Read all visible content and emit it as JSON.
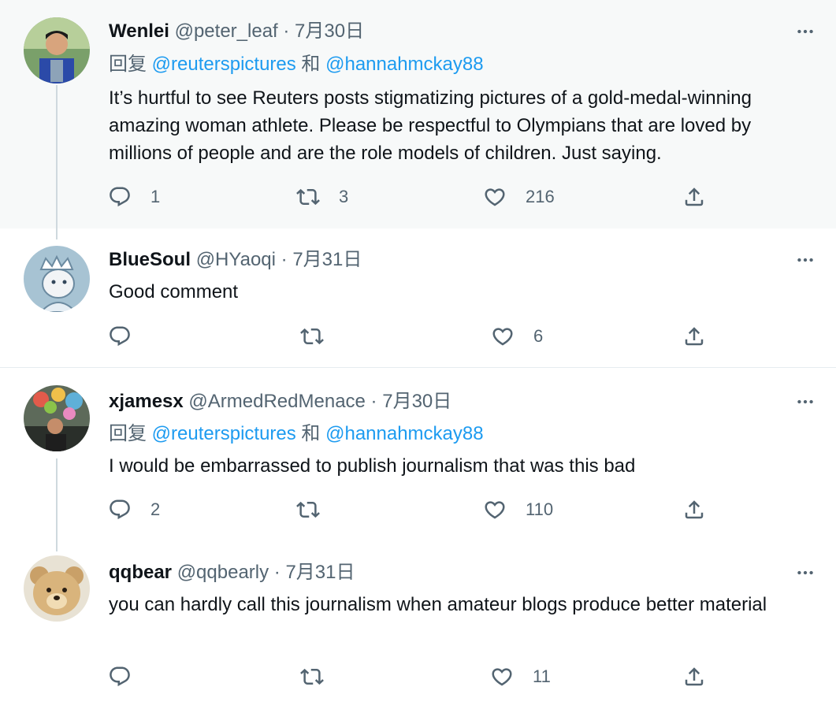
{
  "tweets": [
    {
      "name": "Wenlei",
      "handle": "@peter_leaf",
      "sep": " · ",
      "date": "7月30日",
      "reply_prefix": "回复 ",
      "mention1": "@reuterspictures",
      "conj": " 和 ",
      "mention2": "@hannahmckay88",
      "text": "It’s hurtful to see Reuters posts stigmatizing pictures of a gold-medal-winning amazing woman athlete. Please be respectful to Olympians that are loved by millions of people and are the role models of children. Just saying.",
      "replies": "1",
      "retweets": "3",
      "likes": "216"
    },
    {
      "name": "BlueSoul",
      "handle": "@HYaoqi",
      "sep": " · ",
      "date": "7月31日",
      "text": "Good comment",
      "replies": "",
      "retweets": "",
      "likes": "6"
    },
    {
      "name": "xjamesx",
      "handle": "@ArmedRedMenace",
      "sep": " · ",
      "date": "7月30日",
      "reply_prefix": "回复 ",
      "mention1": "@reuterspictures",
      "conj": " 和 ",
      "mention2": "@hannahmckay88",
      "text": "I would be embarrassed to publish journalism that was this bad",
      "replies": "2",
      "retweets": "",
      "likes": "110"
    },
    {
      "name": "qqbear",
      "handle": "@qqbearly",
      "sep": " · ",
      "date": "7月31日",
      "text": "you can hardly call this journalism when amateur blogs produce better material",
      "replies": "",
      "retweets": "",
      "likes": "11"
    }
  ],
  "colors": {
    "accent": "#1d9bf0",
    "muted": "#536471",
    "text": "#0f1419",
    "highlight_bg": "#f7f9f9"
  },
  "icons": {
    "reply": "speech-bubble-icon",
    "retweet": "retweet-arrows-icon",
    "like": "heart-icon",
    "share": "share-upload-icon",
    "more": "three-dots-icon"
  }
}
